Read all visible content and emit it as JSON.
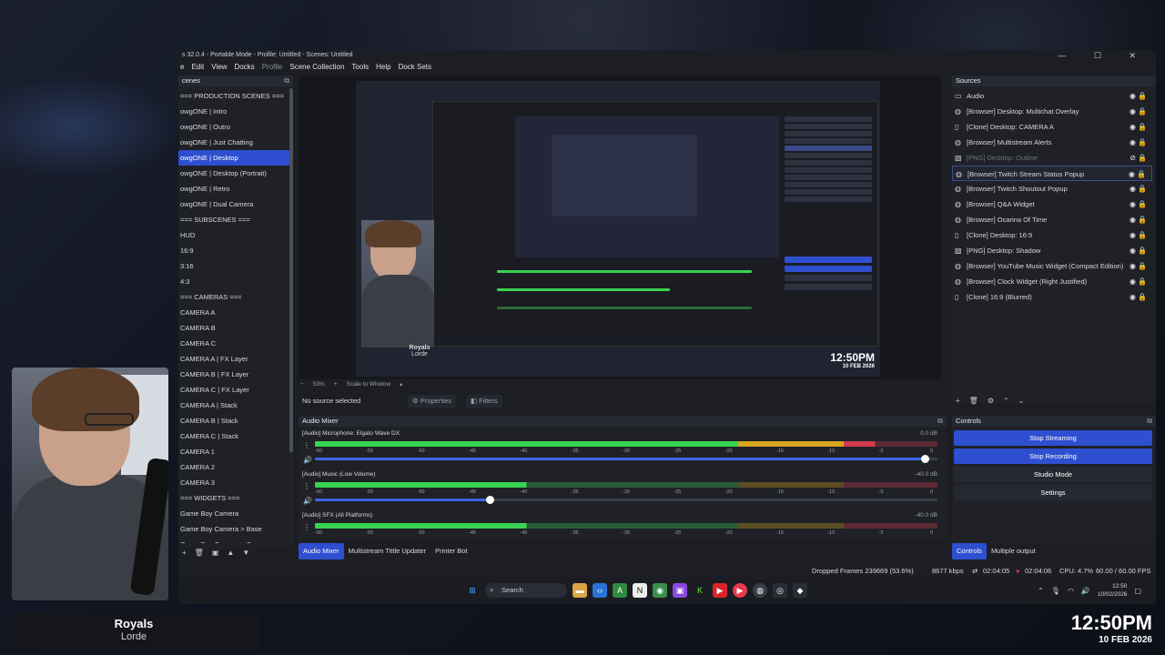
{
  "window": {
    "title": "s 32.0.4 - Portable Mode - Profile: Untitled - Scenes: Untitled",
    "controls": "— ☐ ✕"
  },
  "menu": [
    "e",
    "Edit",
    "View",
    "Docks",
    "Profile",
    "Scene Collection",
    "Tools",
    "Help",
    "Dock Sets"
  ],
  "scenes": {
    "header": "cenes",
    "items": [
      "=== PRODUCTION SCENES ===",
      "owgONE | Intro",
      "owgONE | Outro",
      "owgONE | Just Chatting",
      "owgONE | Desktop",
      "owgONE | Desktop (Portrait)",
      "owgONE | Retro",
      "owgONE | Dual Camera",
      "=== SUBSCENES ===",
      "HUD",
      "16:9",
      "3:16",
      "4:3",
      "=== CAMERAS ===",
      "CAMERA A",
      "CAMERA B",
      "CAMERA C",
      "CAMERA A | FX Layer",
      "CAMERA B | FX Layer",
      "CAMERA C | FX Layer",
      "CAMERA A | Stack",
      "CAMERA B | Stack",
      "CAMERA C | Stack",
      "CAMERA 1",
      "CAMERA 2",
      "CAMERA 3",
      "=== WIDGETS ===",
      "Game Boy Camera",
      "Game Boy Camera > Base",
      "Game Boy Camera > Screen"
    ],
    "selected_index": 4
  },
  "preview": {
    "zoom": "53%",
    "scale_mode": "Scale to Window",
    "canvas_song": "Royals",
    "canvas_artist": "Lorde",
    "canvas_time": "12:50PM",
    "canvas_date": "10 FEB 2026"
  },
  "source_bar": {
    "label": "No source selected",
    "properties": "Properties",
    "filters": "Filters"
  },
  "mixer": {
    "header": "Audio Mixer",
    "ticks": [
      "-60",
      "-55",
      "-50",
      "-45",
      "-40",
      "-35",
      "-30",
      "-25",
      "-20",
      "-15",
      "-10",
      "-5",
      "0"
    ],
    "channels": [
      {
        "name": "[Audio] Microphone: Elgato Wave DX",
        "db": "0.0 dB",
        "level": 0.98
      },
      {
        "name": "[Audio] Music (Low Volume)",
        "db": "-40.0 dB",
        "level": 0.28
      },
      {
        "name": "[Audio] SFX (All Platforms)",
        "db": "-40.0 dB",
        "level": 0.28
      }
    ]
  },
  "bottom_tabs": [
    "Audio Mixer",
    "Multistream Tittle Updater",
    "Printer Bot"
  ],
  "right_tabs": [
    "Controls",
    "Multiple output"
  ],
  "sources": {
    "header": "Sources",
    "items": [
      {
        "label": "Audio",
        "icon": "folder-icon",
        "dim": false
      },
      {
        "label": "[Browser] Desktop: Multichat Overlay",
        "icon": "globe-icon",
        "dim": false
      },
      {
        "label": "[Clone] Desktop: CAMERA A",
        "icon": "document-icon",
        "dim": false
      },
      {
        "label": "[Browser] Multistream Alerts",
        "icon": "globe-icon",
        "dim": false
      },
      {
        "label": "[PNG] Desktop: Outline",
        "icon": "image-icon",
        "dim": true
      },
      {
        "label": "[Browser] Twitch Stream Status Popup",
        "icon": "globe-icon",
        "dim": false
      },
      {
        "label": "[Browser] Twitch Shoutout Popup",
        "icon": "globe-icon",
        "dim": false
      },
      {
        "label": "[Browser] Q&A Widget",
        "icon": "globe-icon",
        "dim": false
      },
      {
        "label": "[Browser] Ocarina Of Time",
        "icon": "globe-icon",
        "dim": false
      },
      {
        "label": "[Clone] Desktop: 16:9",
        "icon": "document-icon",
        "dim": false
      },
      {
        "label": "[PNG] Desktop: Shadow",
        "icon": "image-icon",
        "dim": false
      },
      {
        "label": "[Browser] YouTube Music Widget (Compact Edition)",
        "icon": "globe-icon",
        "dim": false
      },
      {
        "label": "[Browser] Clock Widget (Right Justified)",
        "icon": "globe-icon",
        "dim": false
      },
      {
        "label": "[Clone] 16:9 (Blurred)",
        "icon": "document-icon",
        "dim": false
      }
    ],
    "selected_index": 5
  },
  "controls": {
    "header": "Controls",
    "stop_streaming": "Stop Streaming",
    "stop_recording": "Stop Recording",
    "studio_mode": "Studio Mode",
    "settings": "Settings"
  },
  "status": {
    "dropped": "Dropped Frames 239669 (53.6%)",
    "bitrate": "8677 kbps",
    "stream_time": "02:04:05",
    "rec_time": "02:04:06",
    "cpu": "CPU: 4.7%",
    "fps": "60.00 / 60.00 FPS"
  },
  "taskbar": {
    "search": "Search",
    "time": "12:50",
    "date": "10/02/2026"
  },
  "overlay": {
    "song": "Royals",
    "artist": "Lorde",
    "time": "12:50PM",
    "date": "10 FEB 2026"
  },
  "colors": {
    "accent": "#2e4fd0",
    "meter_green": "#39d353",
    "meter_yellow": "#d8a51f",
    "meter_red": "#d43a4e"
  }
}
